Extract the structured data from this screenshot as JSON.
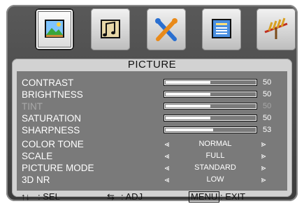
{
  "icons": [
    {
      "name": "picture-icon",
      "selected": true
    },
    {
      "name": "audio-icon",
      "selected": false
    },
    {
      "name": "setup-icon",
      "selected": false
    },
    {
      "name": "option-icon",
      "selected": false
    },
    {
      "name": "channel-icon",
      "selected": false
    }
  ],
  "menu": {
    "title": "PICTURE",
    "sliders": [
      {
        "label": "CONTRAST",
        "value": "50",
        "level": 50,
        "enabled": true
      },
      {
        "label": "BRIGHTNESS",
        "value": "50",
        "level": 50,
        "enabled": true
      },
      {
        "label": "TINT",
        "value": "50",
        "level": 50,
        "enabled": false
      },
      {
        "label": "SATURATION",
        "value": "50",
        "level": 50,
        "enabled": true
      },
      {
        "label": "SHARPNESS",
        "value": "53",
        "level": 53,
        "enabled": true
      }
    ],
    "options": [
      {
        "label": "COLOR TONE",
        "value": "NORMAL"
      },
      {
        "label": "SCALE",
        "value": "FULL"
      },
      {
        "label": "PICTURE MODE",
        "value": "STANDARD"
      },
      {
        "label": "3D NR",
        "value": "LOW"
      }
    ]
  },
  "footer": {
    "sel_arrows": "↑↓",
    "sel_label": ": SEL",
    "adj_arrows": "⇆",
    "adj_label": ": ADJ",
    "menu_key": "MENU",
    "exit_label": ": EXIT"
  },
  "colors": {
    "frame": "#4a4a4a",
    "panel": "#d2d2d2",
    "list_bg": "#7a7a7a",
    "text": "#ffffff",
    "disabled_text": "#a9a9a9"
  }
}
